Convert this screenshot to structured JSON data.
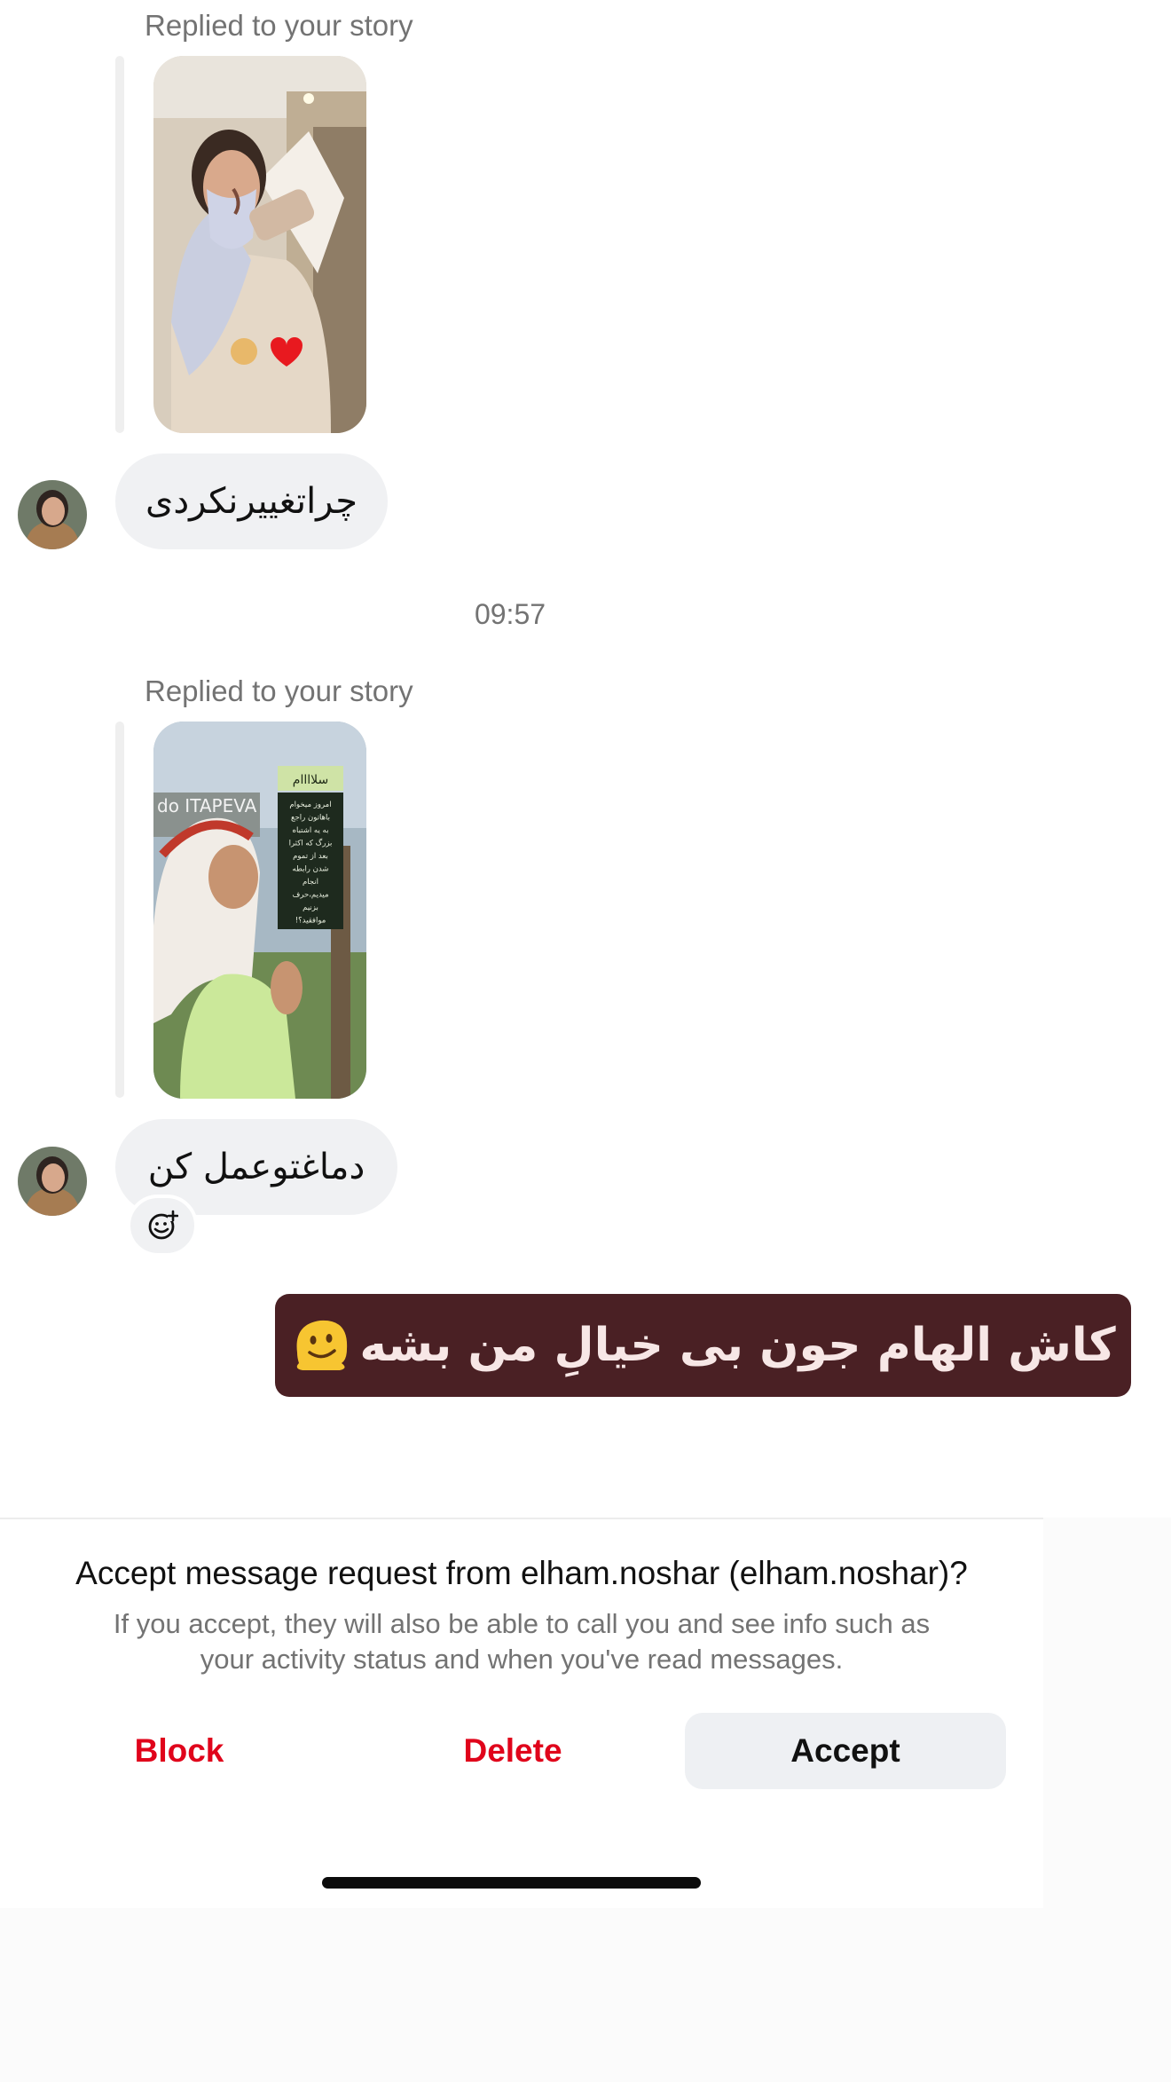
{
  "conversation": {
    "story_reply_1": {
      "label": "Replied to your story",
      "thumbnail_icon": "story-photo-woman-with-scarf"
    },
    "message_1": {
      "text": "چراتغییرنکردی",
      "sender_avatar_icon": "avatar-photo"
    },
    "timestamp": "09:57",
    "story_reply_2": {
      "label": "Replied to your story",
      "thumbnail_icon": "story-photo-woman-with-headdress",
      "sticker_title": "سلاااام",
      "sticker_lines": [
        "امروز میخوام",
        "باهاتون راجع",
        "به یه اشتباه",
        "بزرگ که اکثرا",
        "بعد از تموم",
        "شدن رابطه",
        "انجام",
        "میدیم،حرف",
        "بزنیم",
        "موافقید؟!"
      ],
      "sign_text": "do ITAPEVA"
    },
    "message_2": {
      "text": "دماغتوعمل کن",
      "sender_avatar_icon": "avatar-photo",
      "react_icon": "add-reaction-icon"
    },
    "outgoing_sticker": {
      "text": "کاش الهام جون بی خیالِ من بشه",
      "emoji_icon": "melting-face-emoji"
    }
  },
  "request": {
    "title": "Accept message request from elham.noshar (elham.noshar)?",
    "subtitle_line1": "If you accept, they will also be able to call you and see info such as",
    "subtitle_line2": "your activity status and when you've read messages.",
    "block_label": "Block",
    "delete_label": "Delete",
    "accept_label": "Accept"
  },
  "colors": {
    "danger": "#e0041b",
    "incoming_bubble": "#f0f1f3",
    "sticker_bg": "#4a2024",
    "sticker_text": "#f7e7e6"
  }
}
